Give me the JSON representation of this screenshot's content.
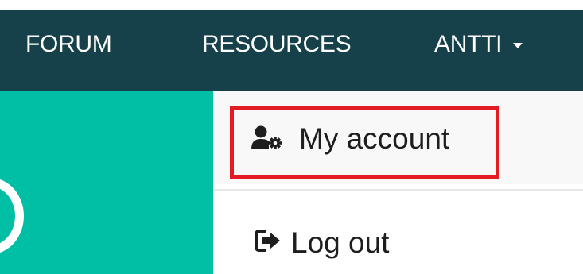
{
  "navbar": {
    "items": [
      {
        "label": "FORUM"
      },
      {
        "label": "RESOURCES"
      },
      {
        "label": "ANTTI"
      }
    ]
  },
  "dropdown": {
    "items": [
      {
        "label": "My account",
        "icon": "user-cog-icon"
      },
      {
        "label": "Log out",
        "icon": "sign-out-icon"
      }
    ]
  },
  "colors": {
    "navbar_bg": "#17414a",
    "hero_bg": "#00bfa5",
    "highlight": "#e31b23"
  }
}
